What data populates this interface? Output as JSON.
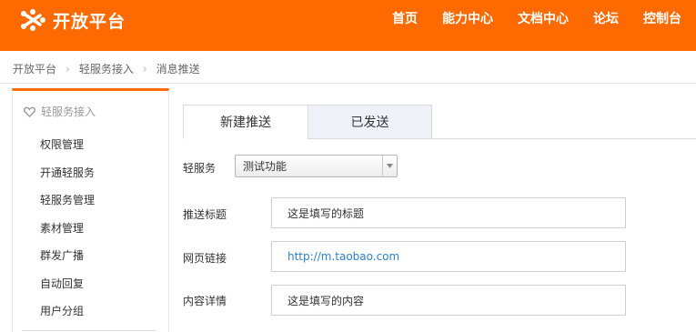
{
  "header": {
    "logo_text": "开放平台",
    "nav": [
      "首页",
      "能力中心",
      "文档中心",
      "论坛",
      "控制台"
    ]
  },
  "breadcrumb": [
    "开放平台",
    "轻服务接入",
    "消息推送"
  ],
  "sidebar": {
    "heading": "轻服务接入",
    "items": [
      "权限管理",
      "开通轻服务",
      "轻服务管理",
      "素材管理",
      "群发广播",
      "自动回复",
      "用户分组"
    ]
  },
  "tabs": [
    "新建推送",
    "已发送"
  ],
  "form": {
    "service_label": "轻服务",
    "service_value": "测试功能",
    "title_label": "推送标题",
    "title_value": "这是填写的标题",
    "link_label": "网页链接",
    "link_value": "http://m.taobao.com",
    "content_label": "内容详情",
    "content_value": "这是填写的内容"
  },
  "colors": {
    "brand": "#ff6a00",
    "link": "#2e7fc8",
    "tab_inactive_bg": "#eef2f8"
  }
}
